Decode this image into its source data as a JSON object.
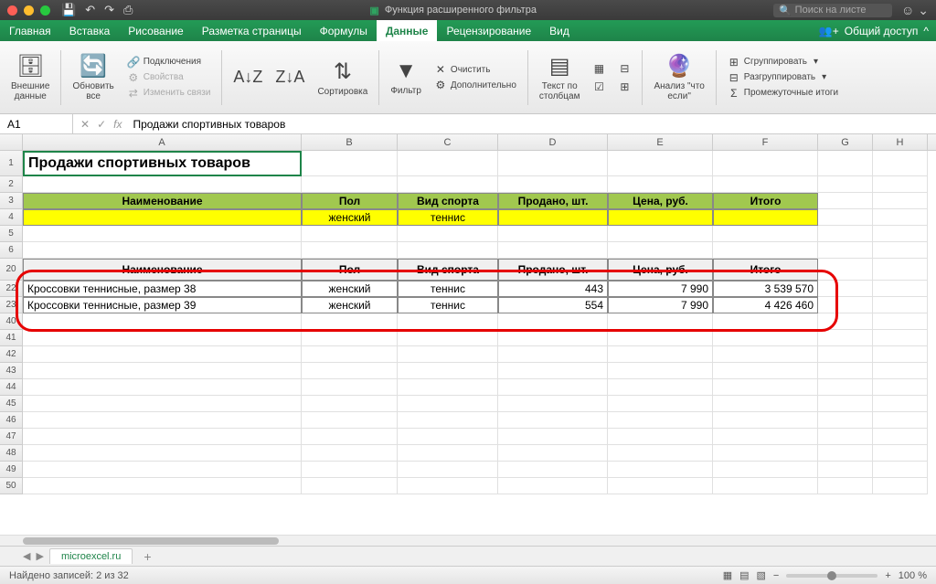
{
  "titlebar": {
    "app_icon": "X",
    "doc_title": "Функция расширенного фильтра",
    "search_placeholder": "Поиск на листе"
  },
  "tabs": [
    "Главная",
    "Вставка",
    "Рисование",
    "Разметка страницы",
    "Формулы",
    "Данные",
    "Рецензирование",
    "Вид"
  ],
  "active_tab_index": 5,
  "share_label": "Общий доступ",
  "ribbon": {
    "external_data": "Внешние\nданные",
    "refresh": "Обновить\nвсе",
    "connections": "Подключения",
    "properties": "Свойства",
    "edit_links": "Изменить связи",
    "sort": "Сортировка",
    "filter": "Фильтр",
    "clear": "Очистить",
    "advanced": "Дополнительно",
    "text_to_cols": "Текст по\nстолбцам",
    "whatif": "Анализ \"что\nесли\"",
    "group": "Сгруппировать",
    "ungroup": "Разгруппировать",
    "subtotal": "Промежуточные итоги"
  },
  "formula_bar": {
    "cell_ref": "A1",
    "formula": "Продажи спортивных товаров"
  },
  "columns": [
    "A",
    "B",
    "C",
    "D",
    "E",
    "F",
    "G",
    "H"
  ],
  "row_labels": [
    "1",
    "2",
    "3",
    "4",
    "5",
    "6",
    "20",
    "22",
    "23",
    "40",
    "41",
    "42",
    "43",
    "44",
    "45",
    "46",
    "47",
    "48",
    "49",
    "50"
  ],
  "sheet": {
    "title": "Продажи спортивных товаров",
    "headers": [
      "Наименование",
      "Пол",
      "Вид спорта",
      "Продано, шт.",
      "Цена, руб.",
      "Итого"
    ],
    "criteria": [
      "",
      "женский",
      "теннис",
      "",
      "",
      ""
    ],
    "result_headers": [
      "Наименование",
      "Пол",
      "Вид спорта",
      "Продано, шт.",
      "Цена, руб.",
      "Итого"
    ],
    "result_rows": [
      [
        "Кроссовки теннисные, размер 38",
        "женский",
        "теннис",
        "443",
        "7 990",
        "3 539 570"
      ],
      [
        "Кроссовки теннисные, размер 39",
        "женский",
        "теннис",
        "554",
        "7 990",
        "4 426 460"
      ]
    ]
  },
  "sheet_tab": "microexcel.ru",
  "status": {
    "found": "Найдено записей: 2 из 32",
    "zoom": "100 %"
  }
}
